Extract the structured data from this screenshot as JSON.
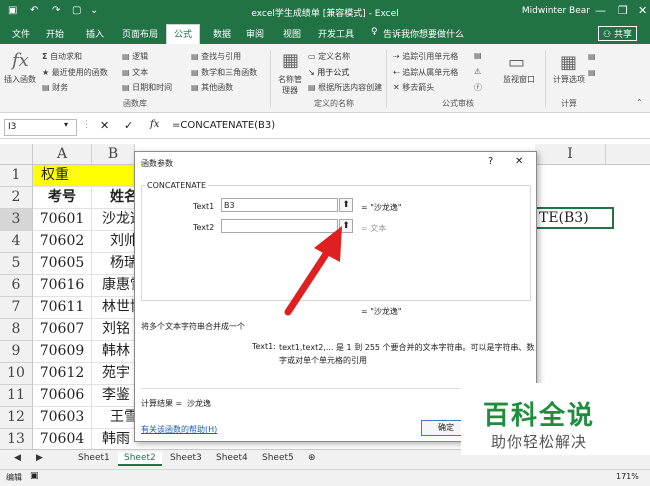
{
  "window": {
    "title": "excel学生成绩单 [兼容模式] - Excel",
    "user": "Midwinter Bear",
    "minimize": "—",
    "restore": "❐",
    "close": "✕"
  },
  "tabs": [
    "文件",
    "开始",
    "插入",
    "页面布局",
    "公式",
    "数据",
    "审阅",
    "视图",
    "开发工具"
  ],
  "active_tab": "公式",
  "tell_me": "告诉我你想要做什么",
  "share": "共享",
  "ribbon": {
    "insert_function": "插入函数",
    "autosum": "自动求和",
    "recent": "最近使用的函数",
    "financial": "财务",
    "logical": "逻辑",
    "text": "文本",
    "datetime": "日期和时间",
    "lookup": "查找与引用",
    "mathtrig": "数学和三角函数",
    "more": "其他函数",
    "group_library": "函数库",
    "name_manager": "名称管理器",
    "define_name": "定义名称",
    "use_in_formula": "用于公式",
    "create_from_selection": "根据所选内容创建",
    "group_names": "定义的名称",
    "trace_precedents": "追踪引用单元格",
    "trace_dependents": "追踪从属单元格",
    "remove_arrows": "移去箭头",
    "group_audit": "公式审核",
    "watch_window": "监视窗口",
    "calc_options": "计算选项",
    "group_calc": "计算"
  },
  "formula_bar": {
    "name_box": "I3",
    "formula": "=CONCATENATE(B3)"
  },
  "columns": [
    "A",
    "B",
    "C",
    "D",
    "E",
    "F",
    "G",
    "H",
    "I"
  ],
  "rows": [
    {
      "n": "1",
      "a": "权重",
      "b": ""
    },
    {
      "n": "2",
      "a": "考号",
      "b": "姓名"
    },
    {
      "n": "3",
      "a": "70601",
      "b": "沙龙逸"
    },
    {
      "n": "4",
      "a": "70602",
      "b": "刘帅"
    },
    {
      "n": "5",
      "a": "70605",
      "b": "杨瑞"
    },
    {
      "n": "6",
      "a": "70616",
      "b": "康惠雪"
    },
    {
      "n": "7",
      "a": "70611",
      "b": "林世博"
    },
    {
      "n": "8",
      "a": "70607",
      "b": "刘铭"
    },
    {
      "n": "9",
      "a": "70609",
      "b": "韩林"
    },
    {
      "n": "10",
      "a": "70612",
      "b": "苑宇"
    },
    {
      "n": "11",
      "a": "70606",
      "b": "李鉴"
    },
    {
      "n": "12",
      "a": "70603",
      "b": "王雪"
    },
    {
      "n": "13",
      "a": "70604",
      "b": "韩雨"
    }
  ],
  "cell_I3": "TE(B3)",
  "dialog": {
    "title": "函数参数",
    "help": "?",
    "close": "✕",
    "function_name": "CONCATENATE",
    "arg1_label": "Text1",
    "arg1_value": "B3",
    "arg1_result": "=  \"沙龙逸\"",
    "arg2_label": "Text2",
    "arg2_value": "",
    "arg2_result": "=  文本",
    "overall_result": "=  \"沙龙逸\"",
    "description": "将多个文本字符串合并成一个",
    "arg_help_label": "Text1:",
    "arg_help_line1": "text1,text2,... 是 1 到 255 个要合并的文本字符串。可以是字符串、数",
    "arg_help_line2": "字或对单个单元格的引用",
    "calc_result_label": "计算结果 =",
    "calc_result_value": "沙龙逸",
    "help_link": "有关该函数的帮助(H)",
    "ok": "确定",
    "cancel": "取消"
  },
  "sheets": [
    "Sheet1",
    "Sheet2",
    "Sheet3",
    "Sheet4",
    "Sheet5"
  ],
  "active_sheet": "Sheet2",
  "status": {
    "mode": "编辑",
    "zoom": "171%"
  },
  "watermark": {
    "line1": "百科全说",
    "line2": "助你轻松解决"
  },
  "colors": {
    "excel_green": "#217346",
    "header_yellow": "#ffff00",
    "arrow_red": "#e02020",
    "watermark_green": "#1e8e3e"
  }
}
